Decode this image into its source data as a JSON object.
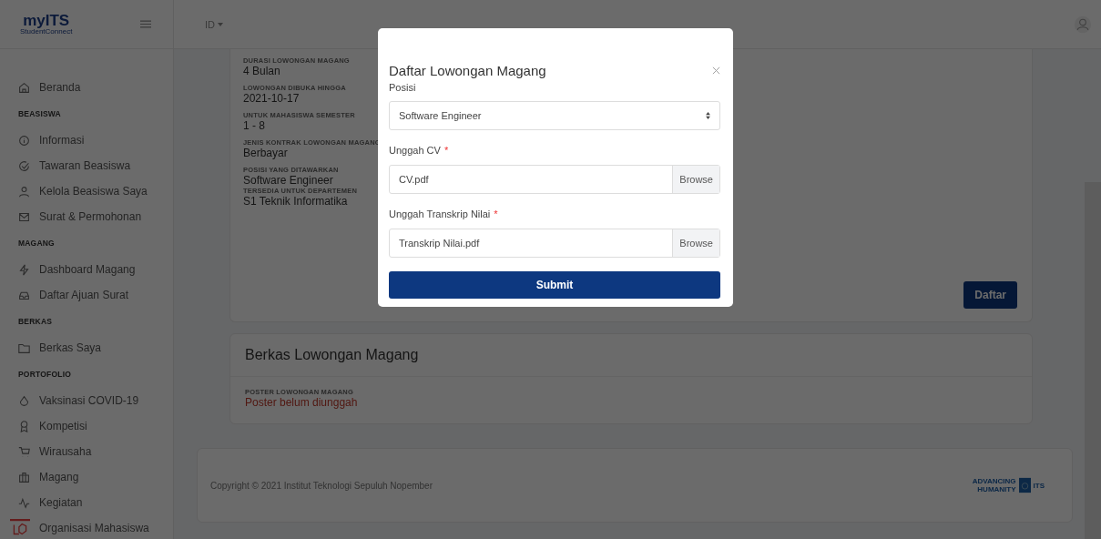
{
  "header": {
    "logo": "myITS",
    "logo_sub": "StudentConnect",
    "language": "ID"
  },
  "sidebar": {
    "items": [
      {
        "kind": "link",
        "label": "Beranda"
      },
      {
        "kind": "section",
        "label": "BEASISWA"
      },
      {
        "kind": "link",
        "label": "Informasi"
      },
      {
        "kind": "link",
        "label": "Tawaran Beasiswa"
      },
      {
        "kind": "link",
        "label": "Kelola Beasiswa Saya"
      },
      {
        "kind": "link",
        "label": "Surat & Permohonan"
      },
      {
        "kind": "section",
        "label": "MAGANG"
      },
      {
        "kind": "link",
        "label": "Dashboard Magang"
      },
      {
        "kind": "link",
        "label": "Daftar Ajuan Surat"
      },
      {
        "kind": "section",
        "label": "BERKAS"
      },
      {
        "kind": "link",
        "label": "Berkas Saya"
      },
      {
        "kind": "section",
        "label": "PORTOFOLIO"
      },
      {
        "kind": "link",
        "label": "Vaksinasi COVID-19"
      },
      {
        "kind": "link",
        "label": "Kompetisi"
      },
      {
        "kind": "link",
        "label": "Wirausaha"
      },
      {
        "kind": "link",
        "label": "Magang"
      },
      {
        "kind": "link",
        "label": "Kegiatan"
      },
      {
        "kind": "link",
        "label": "Organisasi Mahasiswa"
      }
    ]
  },
  "details": {
    "fields": [
      {
        "label": "DURASI LOWONGAN MAGANG",
        "value": "4 Bulan"
      },
      {
        "label": "LOWONGAN DIBUKA HINGGA",
        "value": "2021-10-17"
      },
      {
        "label": "UNTUK MAHASISWA SEMESTER",
        "value": "1 - 8"
      },
      {
        "label": "JENIS KONTRAK LOWONGAN MAGANG",
        "value": "Berbayar"
      },
      {
        "label": "POSISI YANG DITAWARKAN",
        "value": "Software Engineer"
      },
      {
        "label": "TERSEDIA UNTUK DEPARTEMEN",
        "value": "S1 Teknik Informatika"
      }
    ],
    "button": "Daftar"
  },
  "files_card": {
    "title": "Berkas Lowongan Magang",
    "field_label": "POSTER LOWONGAN MAGANG",
    "field_value": "Poster belum diunggah"
  },
  "footer": {
    "copyright": "Copyright © 2021 Institut Teknologi Sepuluh Nopember",
    "logo_line_1": "ADVANCING",
    "logo_line_2": "HUMANITY",
    "logo_its": "ITS"
  },
  "modal": {
    "title": "Daftar Lowongan Magang",
    "position_label": "Posisi",
    "position_value": "Software Engineer",
    "uploads": [
      {
        "label": "Unggah CV",
        "required_mark": "*",
        "value": "CV.pdf",
        "button": "Browse"
      },
      {
        "label": "Unggah Transkrip Nilai",
        "required_mark": "*",
        "value": "Transkrip Nilai.pdf",
        "button": "Browse"
      }
    ],
    "submit": "Submit"
  }
}
